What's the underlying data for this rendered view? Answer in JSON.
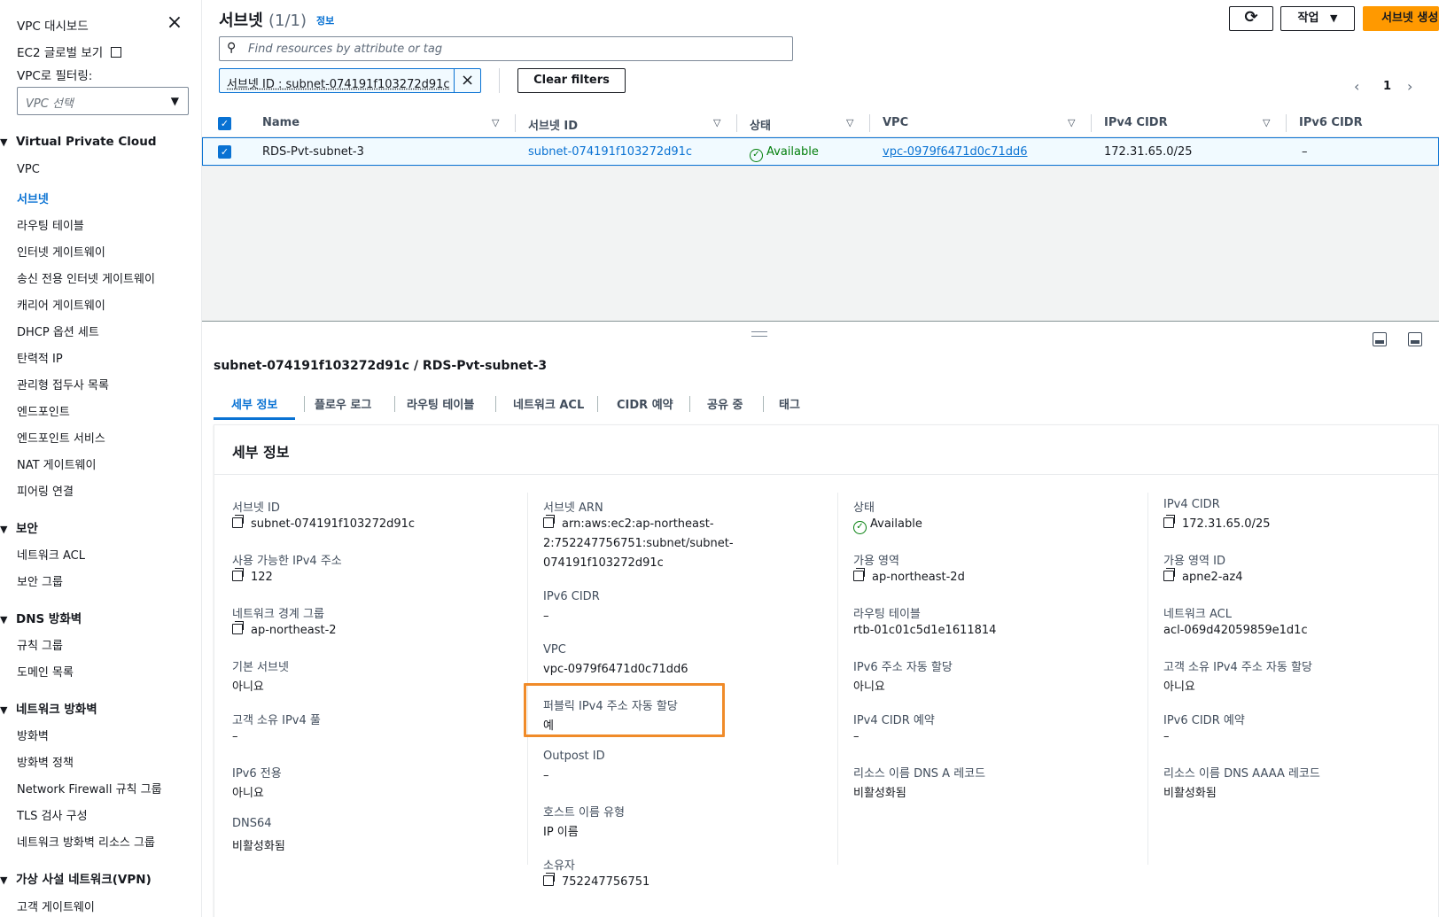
{
  "sidebar": {
    "dashboard": "VPC 대시보드",
    "ec2_global": "EC2 글로벌 보기",
    "filter_label": "VPC로 필터링:",
    "filter_placeholder": "VPC 선택",
    "groups": {
      "vpc": "Virtual Private Cloud",
      "security": "보안",
      "dns": "DNS 방화벽",
      "netfw": "네트워크 방화벽",
      "vpn": "가상 사설 네트워크(VPN)"
    },
    "items": {
      "vpc": "VPC",
      "subnets": "서브넷",
      "route_tables": "라우팅 테이블",
      "igw": "인터넷 게이트웨이",
      "egress_igw": "송신 전용 인터넷 게이트웨이",
      "carrier_gw": "캐리어 게이트웨이",
      "dhcp": "DHCP 옵션 세트",
      "eip": "탄력적 IP",
      "prefix_lists": "관리형 접두사 목록",
      "endpoints": "엔드포인트",
      "endpoint_services": "엔드포인트 서비스",
      "nat": "NAT 게이트웨이",
      "peering": "피어링 연결",
      "nacl": "네트워크 ACL",
      "sg": "보안 그룹",
      "rule_groups": "규칙 그룹",
      "domain_lists": "도메인 목록",
      "firewalls": "방화벽",
      "fw_policies": "방화벽 정책",
      "nf_rule_groups": "Network Firewall 규칙 그룹",
      "tls": "TLS 검사 구성",
      "nf_resource_groups": "네트워크 방화벽 리소스 그룹",
      "cgw": "고객 게이트웨이"
    }
  },
  "header": {
    "title": "서브넷",
    "count": "(1/1)",
    "info": "정보",
    "refresh_icon": "refresh-icon",
    "actions_label": "작업",
    "create_label": "서브넷 생성"
  },
  "filter": {
    "search_placeholder": "Find resources by attribute or tag",
    "token": "서브넷 ID : subnet-074191f103272d91c",
    "clear_label": "Clear filters",
    "page": "1"
  },
  "table": {
    "columns": [
      "Name",
      "서브넷 ID",
      "상태",
      "VPC",
      "IPv4 CIDR",
      "IPv6 CIDR"
    ],
    "row": {
      "name": "RDS-Pvt-subnet-3",
      "subnet_id": "subnet-074191f103272d91c",
      "state": "Available",
      "vpc": "vpc-0979f6471d0c71dd6",
      "ipv4": "172.31.65.0/25",
      "ipv6": "–"
    }
  },
  "split": {
    "title": "subnet-074191f103272d91c / RDS-Pvt-subnet-3",
    "tabs": [
      "세부 정보",
      "플로우 로그",
      "라우팅 테이블",
      "네트워크 ACL",
      "CIDR 예약",
      "공유 중",
      "태그"
    ],
    "details_title": "세부 정보",
    "fields": {
      "subnet_id_l": "서브넷 ID",
      "subnet_id_v": "subnet-074191f103272d91c",
      "avail_ipv4_l": "사용 가능한 IPv4 주소",
      "avail_ipv4_v": "122",
      "nbg_l": "네트워크 경계 그룹",
      "nbg_v": "ap-northeast-2",
      "default_l": "기본 서브넷",
      "default_v": "아니요",
      "cust_pool_l": "고객 소유 IPv4 풀",
      "cust_pool_v": "–",
      "ipv6only_l": "IPv6 전용",
      "ipv6only_v": "아니요",
      "dns64_l": "DNS64",
      "dns64_v": "비활성화됨",
      "arn_l": "서브넷 ARN",
      "arn_v1": "arn:aws:ec2:ap-northeast-",
      "arn_v2": "2:752247756751:subnet/subnet-",
      "arn_v3": "074191f103272d91c",
      "ipv6cidr_l": "IPv6 CIDR",
      "ipv6cidr_v": "–",
      "vpc_l": "VPC",
      "vpc_v": "vpc-0979f6471d0c71dd6",
      "pubip_l": "퍼블릭 IPv4 주소 자동 할당",
      "pubip_v": "예",
      "outpost_l": "Outpost ID",
      "outpost_v": "–",
      "hostname_l": "호스트 이름 유형",
      "hostname_v": "IP 이름",
      "owner_l": "소유자",
      "owner_v": "752247756751",
      "state_l": "상태",
      "state_v": "Available",
      "az_l": "가용 영역",
      "az_v": "ap-northeast-2d",
      "rt_l": "라우팅 테이블",
      "rt_v": "rtb-01c01c5d1e1611814",
      "ipv6auto_l": "IPv6 주소 자동 할당",
      "ipv6auto_v": "아니요",
      "ipv4res_l": "IPv4 CIDR 예약",
      "ipv4res_v": "–",
      "dnsa_l": "리소스 이름 DNS A 레코드",
      "dnsa_v": "비활성화됨",
      "ipv4cidr_l": "IPv4 CIDR",
      "ipv4cidr_v": "172.31.65.0/25",
      "azid_l": "가용 영역 ID",
      "azid_v": "apne2-az4",
      "nacl_l": "네트워크 ACL",
      "nacl_v": "acl-069d42059859e1d1c",
      "custipv4_l": "고객 소유 IPv4 주소 자동 할당",
      "custipv4_v": "아니요",
      "ipv6res_l": "IPv6 CIDR 예약",
      "ipv6res_v": "–",
      "dnsaaaa_l": "리소스 이름 DNS AAAA 레코드",
      "dnsaaaa_v": "비활성화됨"
    }
  },
  "colors": {
    "accent": "#0972d3",
    "primary_button": "#ff9900",
    "success": "#037f0c",
    "highlight": "#f08b29"
  }
}
